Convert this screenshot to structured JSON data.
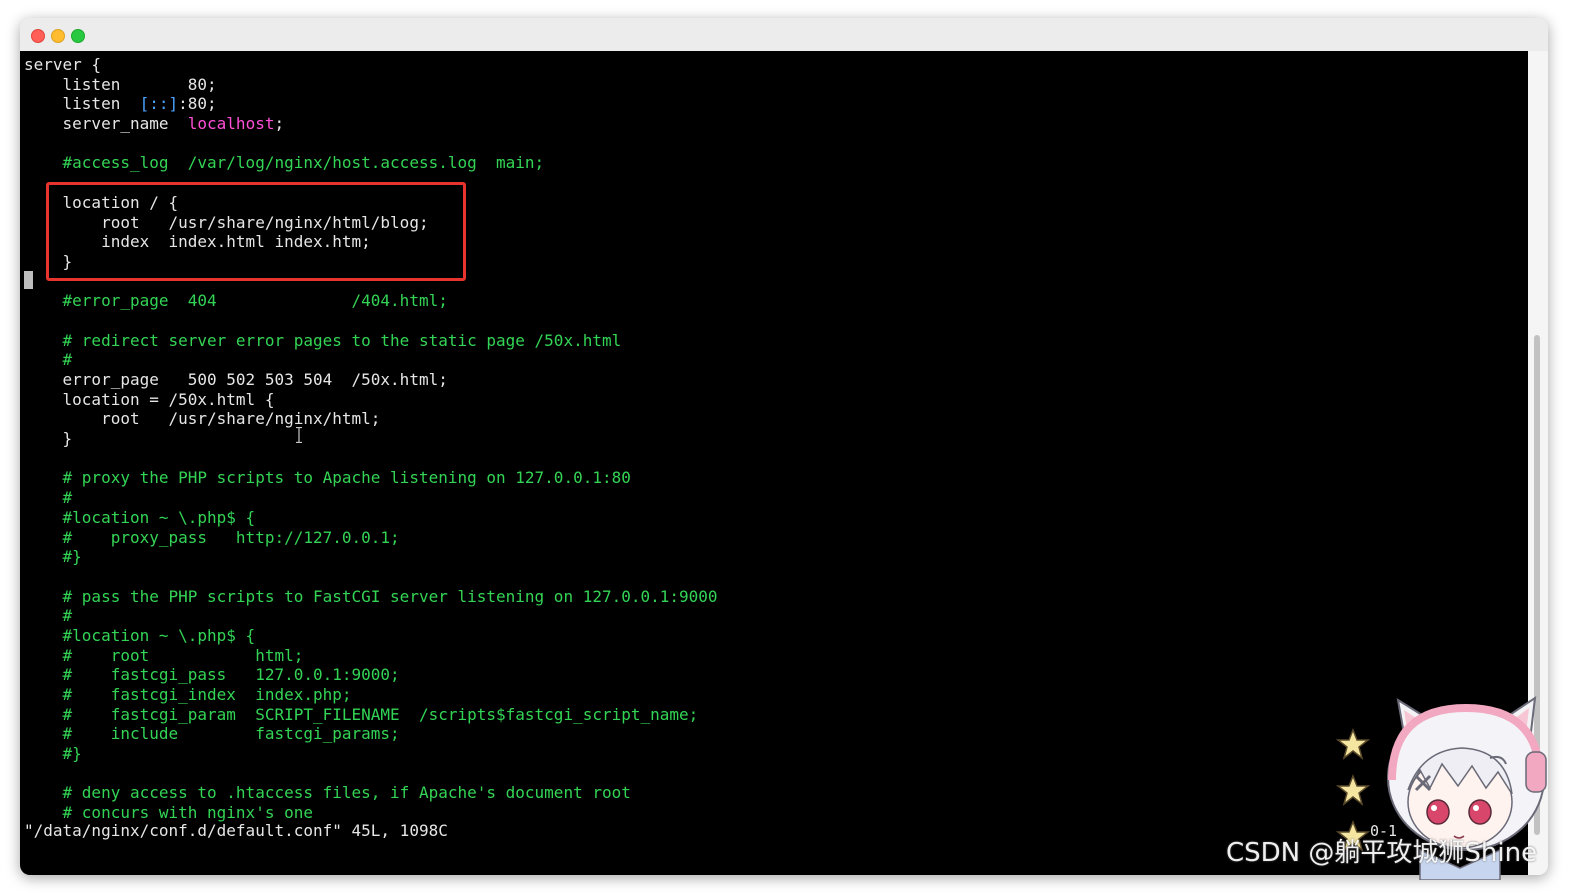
{
  "window": {
    "traffic_lights": {
      "close_color": "#ff5f57",
      "minimize_color": "#febc2e",
      "zoom_color": "#28c840"
    }
  },
  "colors": {
    "comment": "#33d455",
    "ipv6": "#4aa3ff",
    "string": "#ff4fd8",
    "text": "#e6e6e6",
    "highlight": "#e8342f"
  },
  "editor": {
    "lines": [
      [
        {
          "t": "server {",
          "c": "white"
        }
      ],
      [
        {
          "t": "    listen       80;",
          "c": "white"
        }
      ],
      [
        {
          "t": "    listen  ",
          "c": "white"
        },
        {
          "t": "[::]",
          "c": "blue"
        },
        {
          "t": ":80;",
          "c": "white"
        }
      ],
      [
        {
          "t": "    server_name  ",
          "c": "white"
        },
        {
          "t": "localhost",
          "c": "magenta"
        },
        {
          "t": ";",
          "c": "white"
        }
      ],
      [
        {
          "t": "",
          "c": "white"
        }
      ],
      [
        {
          "t": "    #access_log  /var/log/nginx/host.access.log  main;",
          "c": "green"
        }
      ],
      [
        {
          "t": "",
          "c": "white"
        }
      ],
      [
        {
          "t": "    location / {",
          "c": "white"
        }
      ],
      [
        {
          "t": "        root   /usr/share/nginx/html/blog;",
          "c": "white"
        }
      ],
      [
        {
          "t": "        index  index.html index.htm;",
          "c": "white"
        }
      ],
      [
        {
          "t": "    }",
          "c": "white"
        }
      ],
      [
        {
          "t": "",
          "c": "white"
        }
      ],
      [
        {
          "t": "    #error_page  404              /404.html;",
          "c": "green"
        }
      ],
      [
        {
          "t": "",
          "c": "white"
        }
      ],
      [
        {
          "t": "    # redirect server error pages to the static page /50x.html",
          "c": "green"
        }
      ],
      [
        {
          "t": "    #",
          "c": "green"
        }
      ],
      [
        {
          "t": "    error_page   500 502 503 504  /50x.html;",
          "c": "white"
        }
      ],
      [
        {
          "t": "    location = /50x.html {",
          "c": "white"
        }
      ],
      [
        {
          "t": "        root   /usr/share/nginx/html;",
          "c": "white"
        }
      ],
      [
        {
          "t": "    }",
          "c": "white"
        }
      ],
      [
        {
          "t": "",
          "c": "white"
        }
      ],
      [
        {
          "t": "    # proxy the PHP scripts to Apache listening on 127.0.0.1:80",
          "c": "green"
        }
      ],
      [
        {
          "t": "    #",
          "c": "green"
        }
      ],
      [
        {
          "t": "    #location ~ \\.php$ {",
          "c": "green"
        }
      ],
      [
        {
          "t": "    #    proxy_pass   http://127.0.0.1;",
          "c": "green"
        }
      ],
      [
        {
          "t": "    #}",
          "c": "green"
        }
      ],
      [
        {
          "t": "",
          "c": "white"
        }
      ],
      [
        {
          "t": "    # pass the PHP scripts to FastCGI server listening on 127.0.0.1:9000",
          "c": "green"
        }
      ],
      [
        {
          "t": "    #",
          "c": "green"
        }
      ],
      [
        {
          "t": "    #location ~ \\.php$ {",
          "c": "green"
        }
      ],
      [
        {
          "t": "    #    root           html;",
          "c": "green"
        }
      ],
      [
        {
          "t": "    #    fastcgi_pass   127.0.0.1:9000;",
          "c": "green"
        }
      ],
      [
        {
          "t": "    #    fastcgi_index  index.php;",
          "c": "green"
        }
      ],
      [
        {
          "t": "    #    fastcgi_param  SCRIPT_FILENAME  /scripts$fastcgi_script_name;",
          "c": "green"
        }
      ],
      [
        {
          "t": "    #    include        fastcgi_params;",
          "c": "green"
        }
      ],
      [
        {
          "t": "    #}",
          "c": "green"
        }
      ],
      [
        {
          "t": "",
          "c": "white"
        }
      ],
      [
        {
          "t": "    # deny access to .htaccess files, if Apache's document root",
          "c": "green"
        }
      ],
      [
        {
          "t": "    # concurs with nginx's one",
          "c": "green"
        }
      ]
    ],
    "status_line": "\"/data/nginx/conf.d/default.conf\" 45L, 1098C",
    "cursor_position": "0-1"
  },
  "overlay": {
    "watermark": "CSDN @躺平攻城狮Shine",
    "icon": "anime-girl-sticker-icon"
  }
}
